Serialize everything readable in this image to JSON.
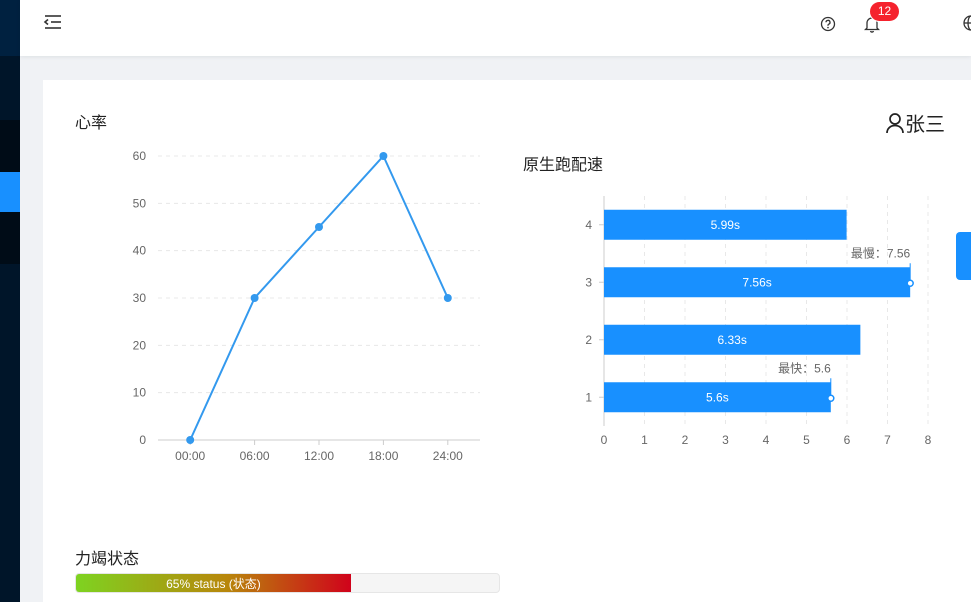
{
  "header": {
    "menu_icon": "menu-fold-icon",
    "help_icon": "question-circle-icon",
    "bell_icon": "bell-icon",
    "notification_count": "12",
    "lang_icon": "globe-icon"
  },
  "user": {
    "icon": "user-icon",
    "name": "张三"
  },
  "heart_rate": {
    "title": "心率",
    "chart_data": {
      "type": "line",
      "categories": [
        "00:00",
        "06:00",
        "12:00",
        "18:00",
        "24:00"
      ],
      "values": [
        0,
        30,
        45,
        60,
        30
      ],
      "yticks": [
        "0",
        "10",
        "20",
        "30",
        "40",
        "50",
        "60"
      ],
      "ylim": [
        0,
        60
      ],
      "grid": true,
      "color": "#3399ee"
    }
  },
  "pace": {
    "title": "原生跑配速",
    "chart_data": {
      "type": "bar",
      "orientation": "horizontal",
      "categories": [
        "1",
        "2",
        "3",
        "4"
      ],
      "values": [
        5.6,
        6.33,
        7.56,
        5.99
      ],
      "bar_labels": [
        "5.6s",
        "6.33s",
        "7.56s",
        "5.99s"
      ],
      "xticks": [
        "0",
        "1",
        "2",
        "3",
        "4",
        "5",
        "6",
        "7",
        "8"
      ],
      "xlim": [
        0,
        8
      ],
      "grid": true,
      "color": "#1890ff",
      "markers": [
        {
          "category": "3",
          "value": 7.56,
          "label": "最慢：7.56"
        },
        {
          "category": "1",
          "value": 5.6,
          "label": "最快：5.6"
        }
      ]
    }
  },
  "fatigue": {
    "title": "力竭状态",
    "percent": 65,
    "label": "65% status (状态)"
  }
}
